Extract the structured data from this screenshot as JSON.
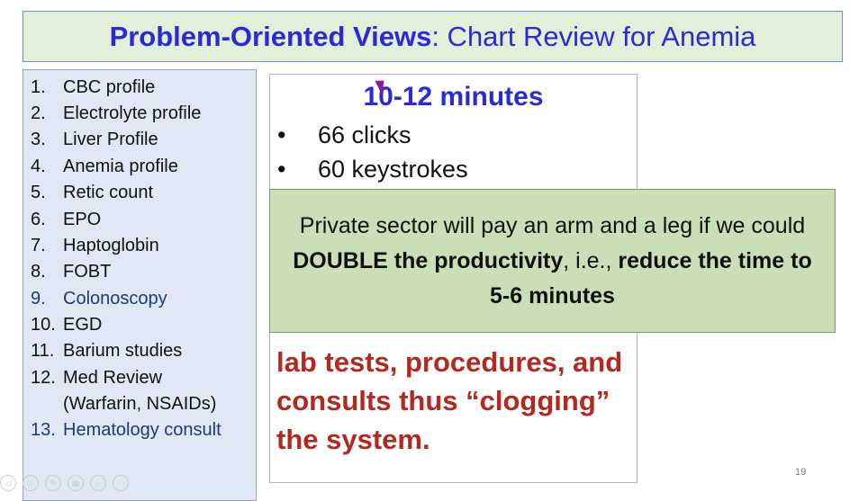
{
  "title": {
    "bold": "Problem-Oriented Views",
    "rest": ": Chart Review for Anemia"
  },
  "list": [
    {
      "num": "1.",
      "label": "CBC profile"
    },
    {
      "num": "2.",
      "label": "Electrolyte profile"
    },
    {
      "num": "3.",
      "label": "Liver Profile"
    },
    {
      "num": "4.",
      "label": "Anemia profile"
    },
    {
      "num": "5.",
      "label": "Retic count"
    },
    {
      "num": "6.",
      "label": "EPO"
    },
    {
      "num": "7.",
      "label": "Haptoglobin"
    },
    {
      "num": "8.",
      "label": "FOBT"
    },
    {
      "num": "9.",
      "label": "Colonoscopy"
    },
    {
      "num": "10.",
      "label": "EGD"
    },
    {
      "num": "11.",
      "label": "Barium studies"
    },
    {
      "num": "12.",
      "label": "Med Review"
    },
    {
      "num": "",
      "label": "(Warfarin, NSAIDs)"
    },
    {
      "num": "13.",
      "label": "Hematology consult"
    }
  ],
  "center": {
    "time": "10-12 minutes",
    "bullets": [
      "66 clicks",
      "60 keystrokes"
    ],
    "bullet_char": "•",
    "red_lines": [
      "lab tests, procedures, and",
      "consults thus “clogging”",
      "the system."
    ]
  },
  "overlay": {
    "t1": "Private sector will pay an arm and a leg if we could ",
    "b1": "DOUBLE the productivity",
    "t2": ", i.e., ",
    "b2": "reduce the time to 5-6 minutes"
  },
  "page_number": "19",
  "controls": [
    "previous-icon",
    "next-icon",
    "pen-icon",
    "slides-icon",
    "zoom-icon",
    "more-icon"
  ],
  "colors": {
    "title": "#2a2ad6",
    "red": "#b3281f",
    "overlay_bg": "#cadfb8",
    "list_bg": "#dfe8f4"
  }
}
